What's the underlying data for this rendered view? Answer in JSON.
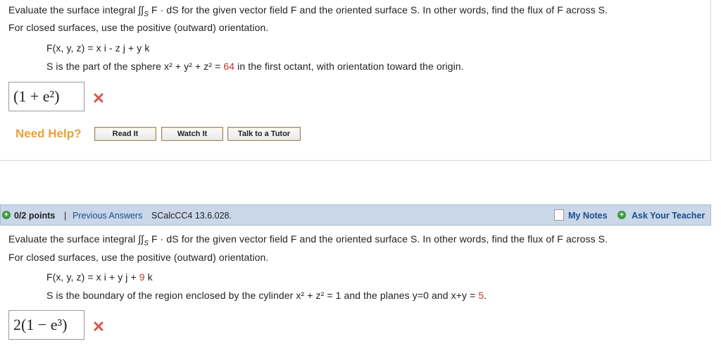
{
  "q1": {
    "intro_1a": "Evaluate the surface integral ",
    "integral_symbol": "∫∫",
    "integral_sub": "S",
    "intro_1b": " F · dS for the given vector field F and the oriented surface S. In other words, find the flux of F across S.",
    "intro_2": "For closed surfaces, use the positive (outward) orientation.",
    "field": "F(x, y, z) = x i - z j + y k",
    "surface_a": "S is the part of the sphere x² + y² + z² = ",
    "surface_num": "64",
    "surface_b": " in the first octant, with orientation toward the origin.",
    "answer": "(1 + e²)"
  },
  "help": {
    "label": "Need Help?",
    "read": "Read It",
    "watch": "Watch It",
    "tutor": "Talk to a Tutor"
  },
  "q2bar": {
    "points": "0/2 points",
    "sep": "|",
    "previous": "Previous Answers",
    "code": "SCalcCC4 13.6.028.",
    "notes": "My Notes",
    "ask": "Ask Your Teacher"
  },
  "q2": {
    "intro_1a": "Evaluate the surface integral ",
    "intro_1b": " F · dS for the given vector field F and the oriented surface S. In other words, find the flux of F across S.",
    "intro_2": "For closed surfaces, use the positive (outward) orientation.",
    "field_a": "F(x, y, z) = x i + y j + ",
    "field_num": "9",
    "field_b": " k",
    "surface_a": "S is the boundary of the region enclosed by the cylinder x² + z² = 1 and the planes y=0 and x+y = ",
    "surface_num": "5",
    "surface_b": ".",
    "answer": "2(1 − e³)"
  },
  "colors": {
    "accent_orange": "#e8a23a",
    "bar_blue": "#c9d7e9",
    "wrong_red": "#d9534f"
  }
}
